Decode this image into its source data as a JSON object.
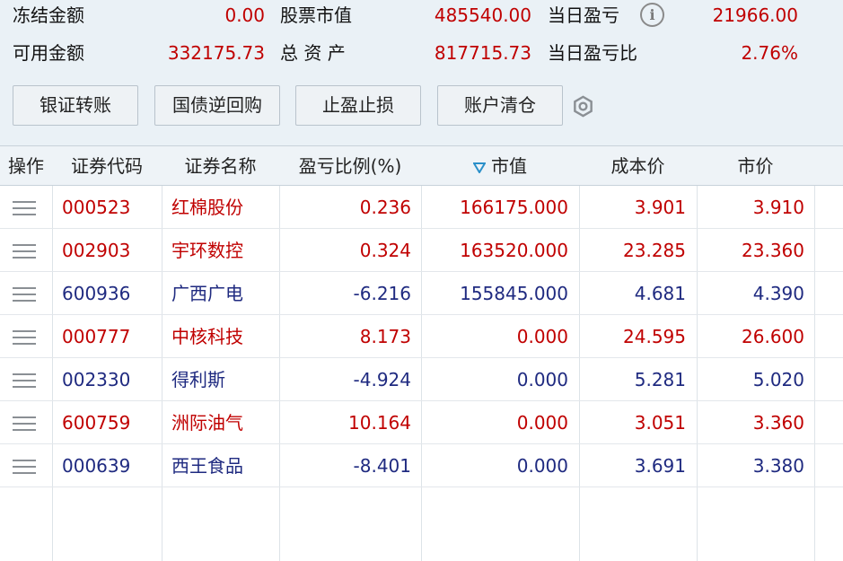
{
  "summary": {
    "frozen_label": "冻结金额",
    "frozen_value": "0.00",
    "stock_mv_label": "股票市值",
    "stock_mv_value": "485540.00",
    "daily_pl_label": "当日盈亏",
    "daily_pl_value": "21966.00",
    "available_label": "可用金额",
    "available_value": "332175.73",
    "total_assets_label": "总 资 产",
    "total_assets_value": "817715.73",
    "daily_pl_ratio_label": "当日盈亏比",
    "daily_pl_ratio_value": "2.76%"
  },
  "buttons": {
    "transfer": "银证转账",
    "repo": "国债逆回购",
    "stop": "止盈止损",
    "clear": "账户清仓"
  },
  "table": {
    "headers": {
      "op": "操作",
      "code": "证券代码",
      "name": "证券名称",
      "ratio": "盈亏比例(%)",
      "mv": "市值",
      "cost": "成本价",
      "price": "市价"
    },
    "sort_indicator_icon": "sort-descending-icon",
    "rows": [
      {
        "code": "000523",
        "name": "红棉股份",
        "ratio": "0.236",
        "mv": "166175.000",
        "cost": "3.901",
        "price": "3.910",
        "color": "red"
      },
      {
        "code": "002903",
        "name": "宇环数控",
        "ratio": "0.324",
        "mv": "163520.000",
        "cost": "23.285",
        "price": "23.360",
        "color": "red"
      },
      {
        "code": "600936",
        "name": "广西广电",
        "ratio": "-6.216",
        "mv": "155845.000",
        "cost": "4.681",
        "price": "4.390",
        "color": "blue"
      },
      {
        "code": "000777",
        "name": "中核科技",
        "ratio": "8.173",
        "mv": "0.000",
        "cost": "24.595",
        "price": "26.600",
        "color": "red"
      },
      {
        "code": "002330",
        "name": "得利斯",
        "ratio": "-4.924",
        "mv": "0.000",
        "cost": "5.281",
        "price": "5.020",
        "color": "blue"
      },
      {
        "code": "600759",
        "name": "洲际油气",
        "ratio": "10.164",
        "mv": "0.000",
        "cost": "3.051",
        "price": "3.360",
        "color": "red"
      },
      {
        "code": "000639",
        "name": "西王食品",
        "ratio": "-8.401",
        "mv": "0.000",
        "cost": "3.691",
        "price": "3.380",
        "color": "blue"
      }
    ]
  },
  "colors": {
    "profit": "#c00000",
    "loss": "#1f2a80",
    "header_bg": "#eef3f7",
    "panel_bg": "#eaf1f6"
  }
}
